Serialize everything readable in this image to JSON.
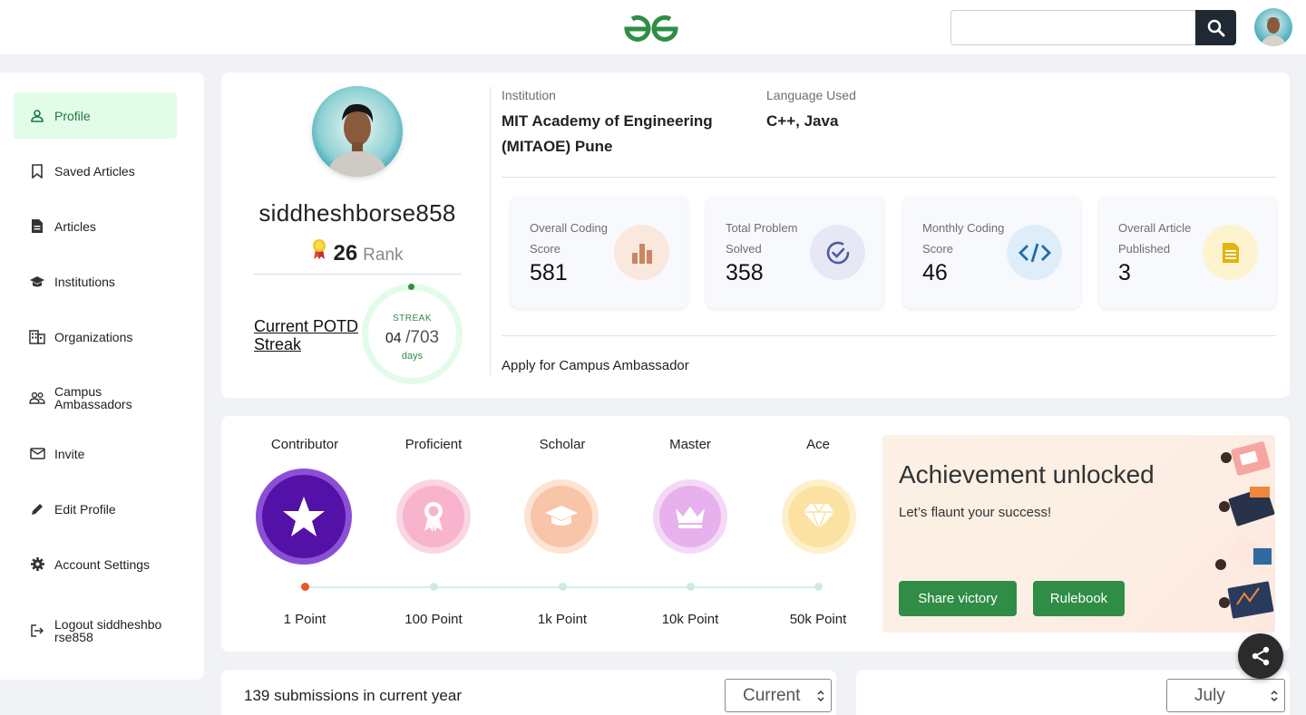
{
  "header": {
    "search_placeholder": "",
    "brand_color": "#2f8d46"
  },
  "sidebar": {
    "items": [
      {
        "label": "Profile",
        "icon": "user-icon",
        "active": true
      },
      {
        "label": "Saved Articles",
        "icon": "bookmark-icon"
      },
      {
        "label": "Articles",
        "icon": "document-icon"
      },
      {
        "label": "Institutions",
        "icon": "graduation-cap-icon"
      },
      {
        "label": "Organizations",
        "icon": "building-icon"
      },
      {
        "label": "Campus Ambassadors",
        "icon": "people-icon"
      },
      {
        "label": "Invite",
        "icon": "mail-icon"
      },
      {
        "label": "Edit Profile",
        "icon": "pencil-icon"
      },
      {
        "label": "Account Settings",
        "icon": "gear-icon"
      },
      {
        "label": "Logout siddheshborse858",
        "icon": "logout-icon"
      }
    ]
  },
  "profile": {
    "username": "siddheshborse858",
    "rank": "26",
    "rank_label": "Rank",
    "potd_label": "Current POTD Streak",
    "streak": {
      "title": "STREAK",
      "current": "04",
      "total": "/703",
      "unit": "days"
    },
    "institution_label": "Institution",
    "institution": "MIT Academy of Engineering (MITAOE) Pune",
    "language_label": "Language Used",
    "languages": "C++, Java",
    "stats": [
      {
        "label": "Overall Coding Score",
        "value": "581",
        "icon": "bar-chart-icon",
        "color": "#fbe8dc"
      },
      {
        "label": "Total Problem Solved",
        "value": "358",
        "icon": "check-circle-icon",
        "color": "#e6e8f6"
      },
      {
        "label": "Monthly Coding Score",
        "value": "46",
        "icon": "code-icon",
        "color": "#ddeefa"
      },
      {
        "label": "Overall Article Published",
        "value": "3",
        "icon": "article-icon",
        "color": "#fdf3cf"
      }
    ],
    "ambassador_link": "Apply for Campus Ambassador"
  },
  "badges": {
    "levels": [
      {
        "title": "Contributor",
        "points": "1 Point",
        "icon": "star-icon",
        "achieved": true
      },
      {
        "title": "Proficient",
        "points": "100 Point",
        "icon": "ribbon-icon"
      },
      {
        "title": "Scholar",
        "points": "1k Point",
        "icon": "mortarboard-icon"
      },
      {
        "title": "Master",
        "points": "10k Point",
        "icon": "crown-icon"
      },
      {
        "title": "Ace",
        "points": "50k Point",
        "icon": "diamond-icon"
      }
    ],
    "achievement": {
      "title": "Achievement unlocked",
      "subtitle": "Let’s flaunt your success!",
      "share_label": "Share victory",
      "rulebook_label": "Rulebook"
    }
  },
  "submissions": {
    "title": "139 submissions in current year",
    "year_select": "Current",
    "month_select": "July"
  }
}
